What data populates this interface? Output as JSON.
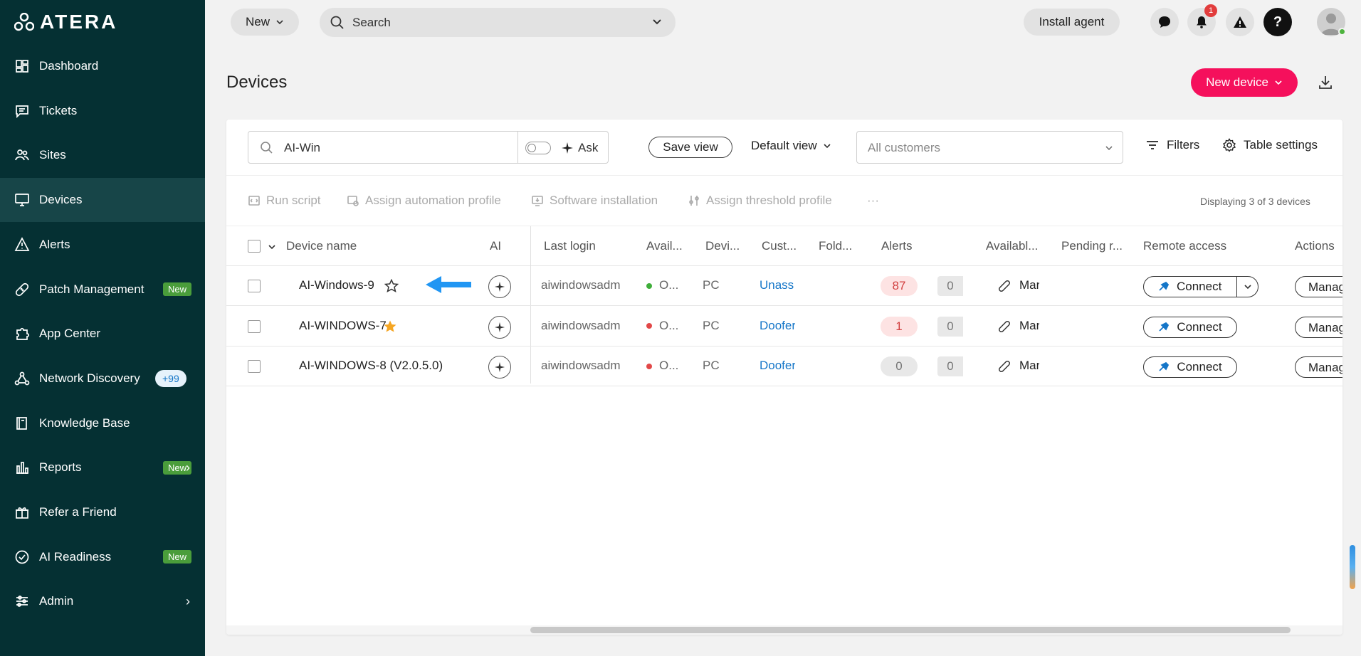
{
  "app": {
    "logo_text": "ATERA"
  },
  "sidebar": {
    "items": [
      {
        "label": "Dashboard",
        "icon": "dashboard-icon"
      },
      {
        "label": "Tickets",
        "icon": "ticket-icon"
      },
      {
        "label": "Sites",
        "icon": "users-icon"
      },
      {
        "label": "Devices",
        "icon": "monitor-icon",
        "active": true
      },
      {
        "label": "Alerts",
        "icon": "warning-icon"
      },
      {
        "label": "Patch Management",
        "icon": "bandage-icon",
        "badge": "New"
      },
      {
        "label": "App Center",
        "icon": "puzzle-icon"
      },
      {
        "label": "Network Discovery",
        "icon": "network-icon",
        "badge": "+99"
      },
      {
        "label": "Knowledge Base",
        "icon": "book-icon"
      },
      {
        "label": "Reports",
        "icon": "chart-icon",
        "badge": "New",
        "chevron": "›"
      },
      {
        "label": "Refer a Friend",
        "icon": "gift-icon"
      },
      {
        "label": "AI Readiness",
        "icon": "check-circle-icon",
        "badge": "New"
      },
      {
        "label": "Admin",
        "icon": "sliders-icon",
        "chevron": "›"
      }
    ]
  },
  "topbar": {
    "new_label": "New",
    "search_placeholder": "Search",
    "install_agent_label": "Install agent",
    "notification_count": "1",
    "help_label": "?"
  },
  "page": {
    "title": "Devices",
    "new_device_label": "New device"
  },
  "toolbar": {
    "filter_value": "AI-Win",
    "ask_label": "Ask",
    "save_view_label": "Save view",
    "default_view_label": "Default view",
    "customers_placeholder": "All customers",
    "filters_label": "Filters",
    "table_settings_label": "Table settings"
  },
  "actions": {
    "run_script": "Run script",
    "assign_automation": "Assign automation profile",
    "software_installation": "Software installation",
    "assign_threshold": "Assign threshold profile",
    "more": "···",
    "displaying": "Displaying 3 of 3 devices"
  },
  "table": {
    "headers": [
      "Device name",
      "AI",
      "Last login",
      "Avail...",
      "Devi...",
      "Cust...",
      "Fold...",
      "Alerts",
      "Availabl...",
      "Pending r...",
      "Remote access",
      "Actions"
    ],
    "rows": [
      {
        "name": "AI-Windows-9",
        "starred": false,
        "last_login": "aiwindowsadm",
        "status": "O...",
        "status_color": "#3fae3a",
        "device_type": "PC",
        "customer": "Unass",
        "alerts": "87",
        "alerts_zero": "0",
        "remote": "Mar",
        "connect": "Connect",
        "split": true,
        "manage": "Manage"
      },
      {
        "name": "AI-WINDOWS-7",
        "starred": true,
        "last_login": "aiwindowsadm",
        "status": "O...",
        "status_color": "#e24848",
        "device_type": "PC",
        "customer": "Doofer",
        "alerts": "1",
        "alerts_zero": "0",
        "remote": "Mar",
        "connect": "Connect",
        "split": false,
        "manage": "Manage"
      },
      {
        "name": "AI-WINDOWS-8 (V2.0.5.0)",
        "starred": false,
        "last_login": "aiwindowsadm",
        "status": "O...",
        "status_color": "#e24848",
        "device_type": "PC",
        "customer": "Doofer",
        "alerts": "0",
        "alerts_zero": "0",
        "remote": "Mar",
        "connect": "Connect",
        "split": false,
        "manage": "Manage"
      }
    ]
  },
  "colors": {
    "sidebar_bg": "#053033",
    "accent_pink": "#f5105c",
    "link_blue": "#1576c8",
    "star_orange": "#f5a623",
    "arrow_blue": "#2196f3"
  }
}
